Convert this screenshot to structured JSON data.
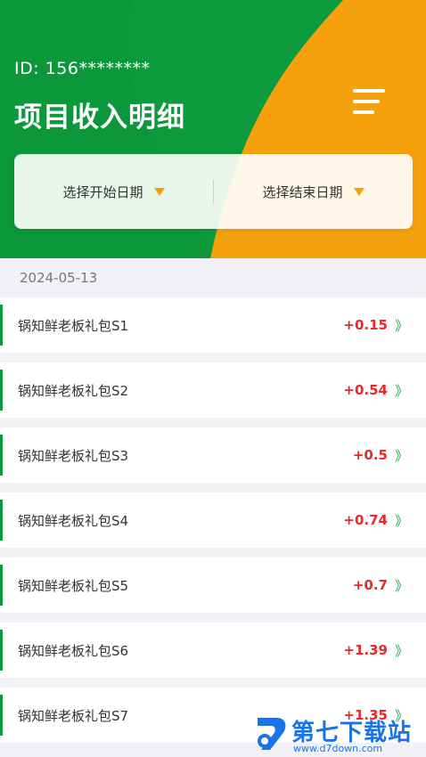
{
  "header": {
    "uid": "ID:  156********",
    "title": "项目收入明细"
  },
  "date_picker": {
    "start_label": "选择开始日期",
    "end_label": "选择结束日期"
  },
  "date_group": "2024-05-13",
  "items": [
    {
      "name": "锅知鲜老板礼包S1",
      "amount": "+0.15"
    },
    {
      "name": "锅知鲜老板礼包S2",
      "amount": "+0.54"
    },
    {
      "name": "锅知鲜老板礼包S3",
      "amount": "+0.5"
    },
    {
      "name": "锅知鲜老板礼包S4",
      "amount": "+0.74"
    },
    {
      "name": "锅知鲜老板礼包S5",
      "amount": "+0.7"
    },
    {
      "name": "锅知鲜老板礼包S6",
      "amount": "+1.39"
    },
    {
      "name": "锅知鲜老板礼包S7",
      "amount": "+1.35"
    }
  ],
  "chevron": "》",
  "watermark": {
    "text": "第七下载站",
    "url": "www.d7down.com"
  },
  "colors": {
    "green": "#0d9a3c",
    "orange": "#f5a00d",
    "amount_red": "#e8282a"
  }
}
